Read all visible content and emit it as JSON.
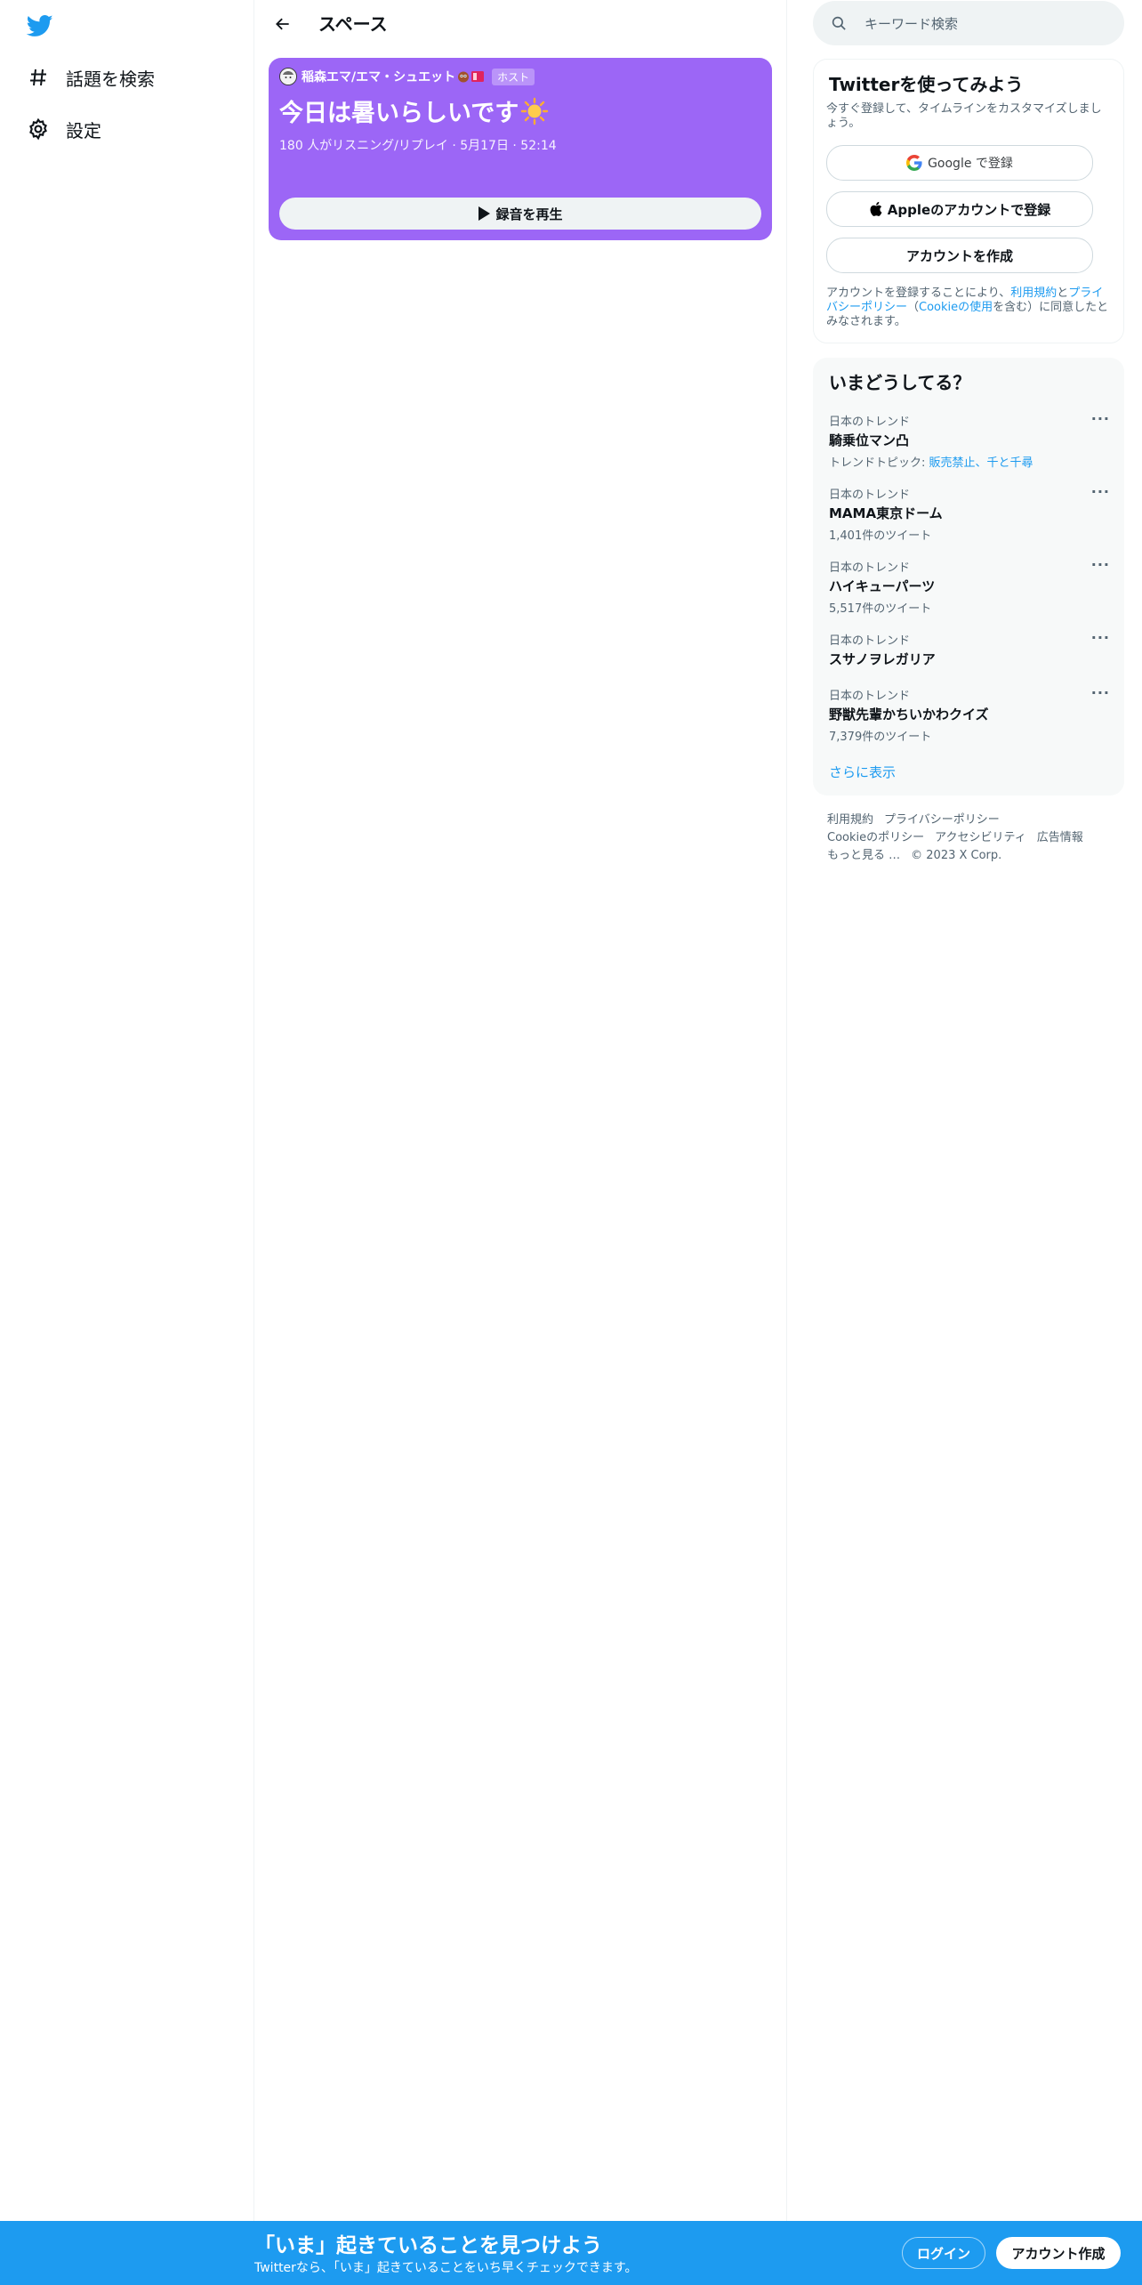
{
  "colors": {
    "brand": "#1d9bf0",
    "space_card": "#9c66f6",
    "text_primary": "#0f1419",
    "text_secondary": "#536471"
  },
  "left_nav": {
    "logo_icon": "twitter-bird-icon",
    "items": [
      {
        "label": "話題を検索",
        "icon": "hashtag-icon"
      },
      {
        "label": "設定",
        "icon": "gear-icon"
      }
    ]
  },
  "header": {
    "title": "スペース",
    "back_icon": "back-arrow-icon"
  },
  "space": {
    "host_name": "稲森エマ/エマ・シュエット",
    "host_badge": "ホスト",
    "title": "今日は暑いらしいです",
    "title_emoji": "sun-icon",
    "meta": "180 人がリスニング/リプレイ · 5月17日 · 52:14",
    "play_label": "録音を再生"
  },
  "search": {
    "placeholder": "キーワード検索"
  },
  "signup": {
    "title": "Twitterを使ってみよう",
    "subtitle": "今すぐ登録して、タイムラインをカスタマイズしましょう。",
    "google_label": "Google で登録",
    "apple_label": "Appleのアカウントで登録",
    "create_label": "アカウントを作成",
    "legal_prefix": "アカウントを登録することにより、",
    "legal_terms": "利用規約",
    "legal_and": "と",
    "legal_privacy": "プライバシーポリシー",
    "legal_paren_open": "（",
    "legal_cookie": "Cookieの使用",
    "legal_suffix": "を含む）に同意したとみなされます。"
  },
  "trends": {
    "title": "いまどうしてる？",
    "items": [
      {
        "category": "日本のトレンド",
        "name": "騎乗位マン凸",
        "count": "",
        "topic_prefix": "トレンドトピック: ",
        "topics": "販売禁止、千と千尋"
      },
      {
        "category": "日本のトレンド",
        "name": "MAMA東京ドーム",
        "count": "1,401件のツイート"
      },
      {
        "category": "日本のトレンド",
        "name": "ハイキューパーツ",
        "count": "5,517件のツイート"
      },
      {
        "category": "日本のトレンド",
        "name": "スサノヲレガリア",
        "count": ""
      },
      {
        "category": "日本のトレンド",
        "name": "野獣先輩かちいかわクイズ",
        "count": "7,379件のツイート"
      }
    ],
    "show_more": "さらに表示"
  },
  "footer": {
    "links": [
      "利用規約",
      "プライバシーポリシー",
      "Cookieのポリシー",
      "アクセシビリティ",
      "広告情報",
      "もっと見る …"
    ],
    "copyright": "© 2023 X Corp."
  },
  "bottom_bar": {
    "title": "「いま」起きていることを見つけよう",
    "subtitle": "Twitterなら、「いま」起きていることをいち早くチェックできます。",
    "login_label": "ログイン",
    "signup_label": "アカウント作成"
  }
}
